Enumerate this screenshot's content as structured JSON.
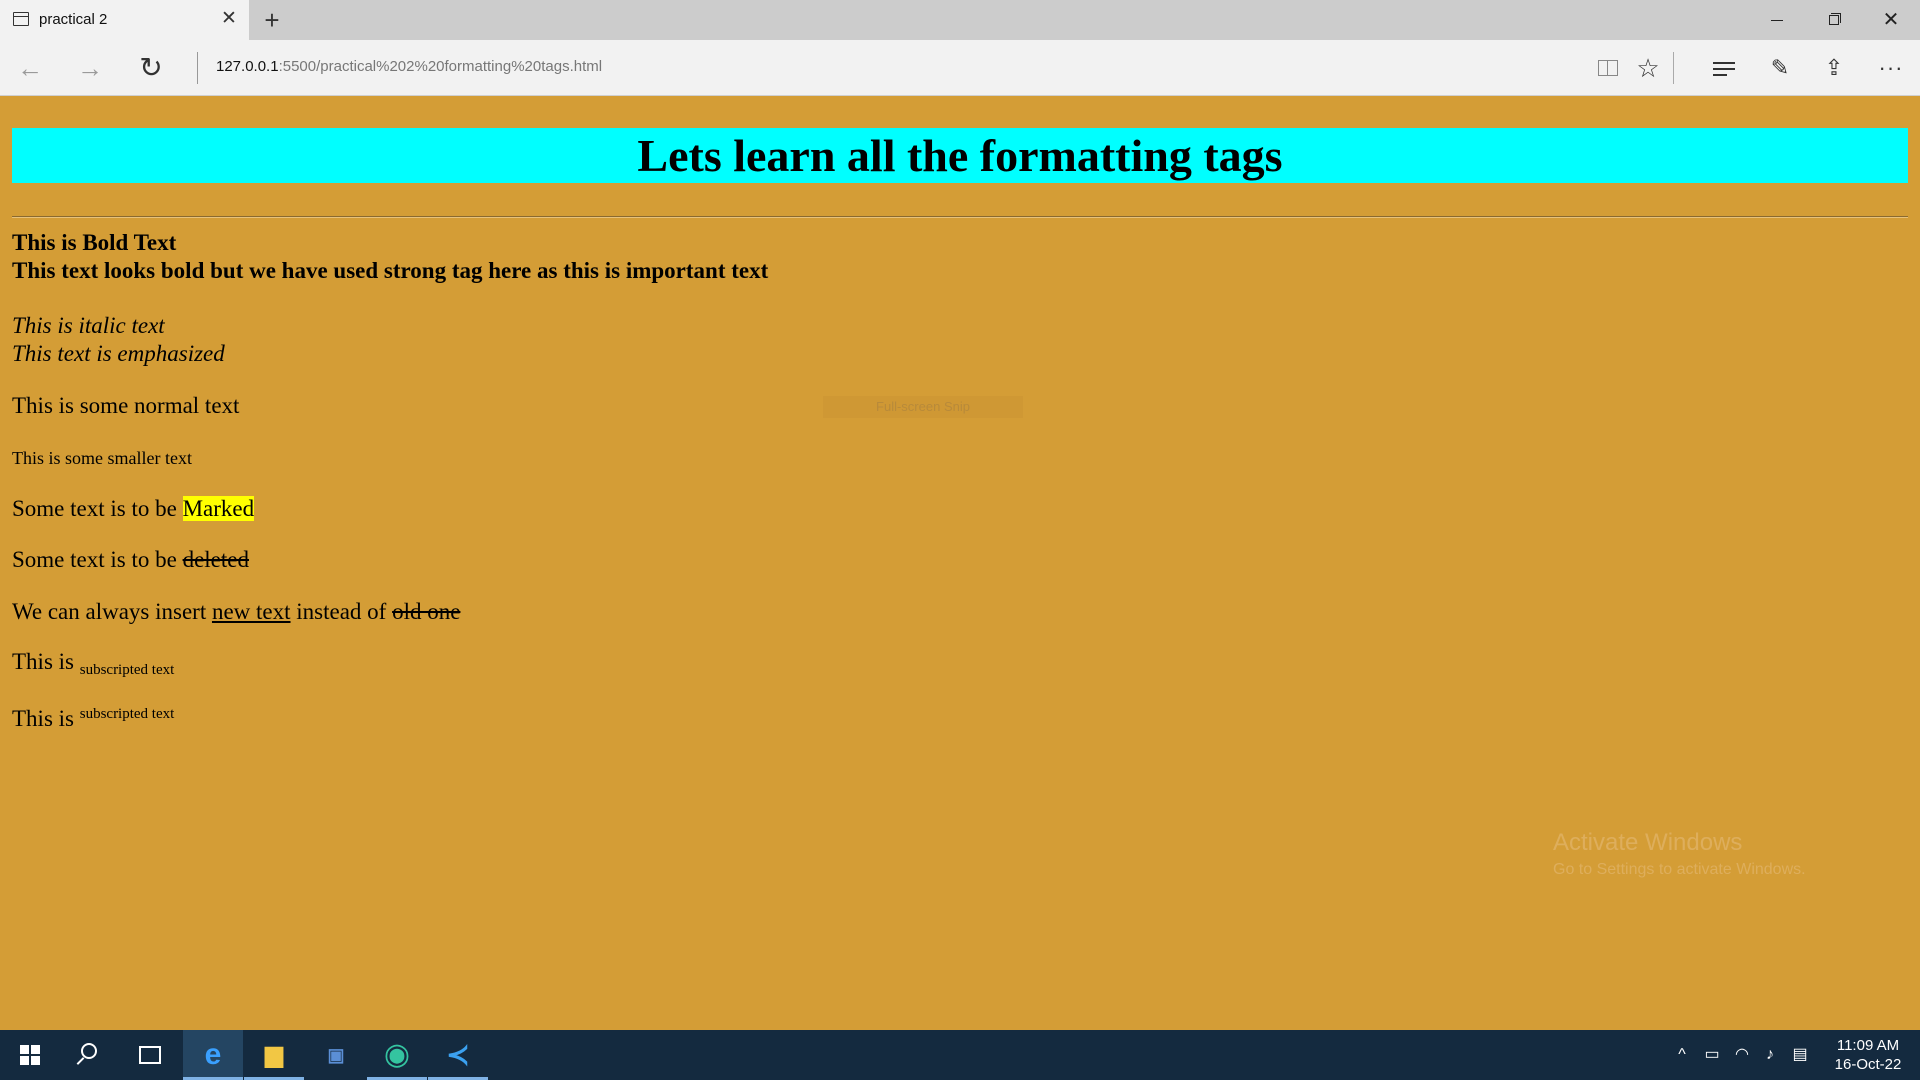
{
  "browser": {
    "tab": {
      "title": "practical 2"
    },
    "address": {
      "host": "127.0.0.1",
      "path": ":5500/practical%202%20formatting%20tags.html"
    }
  },
  "page": {
    "heading": "Lets learn all the formatting tags",
    "bold_text": "This is Bold Text",
    "strong_text": "This text looks bold but we have used strong tag here as this is important text",
    "italic_text": "This is italic text",
    "em_text": "This text is emphasized",
    "normal_text": "This is some normal text",
    "small_text": "This is some smaller text",
    "mark_line": {
      "prefix": "Some text is to be ",
      "marked": "Marked"
    },
    "del_line": {
      "prefix": "Some text is to be ",
      "deleted": "deleted"
    },
    "ins_line": {
      "prefix": "We can always insert ",
      "inserted": "new text",
      "middle": " instead of ",
      "deleted": "old one"
    },
    "sub_line": {
      "prefix": "This is ",
      "sub": "subscripted text"
    },
    "sup_line": {
      "prefix": "This is ",
      "sup": "subscripted text"
    }
  },
  "overlay": {
    "snip_text": "Full-screen Snip"
  },
  "watermark": {
    "title": "Activate Windows",
    "subtitle": "Go to Settings to activate Windows."
  },
  "taskbar": {
    "time": "11:09 AM",
    "date": "16-Oct-22"
  },
  "colors": {
    "page_background": "#d49d36",
    "heading_background": "#00ffff",
    "mark_background": "#ffff00",
    "taskbar": "#142a3f"
  }
}
